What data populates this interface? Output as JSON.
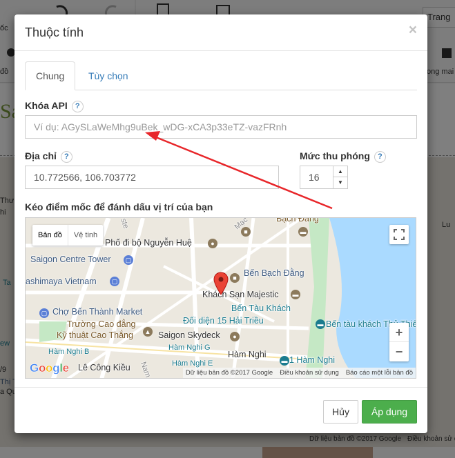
{
  "background": {
    "top_button_label": "Trang",
    "left_tabs": [
      "ốc",
      "đồ",
      "Sá"
    ],
    "right_texts": [
      "ong mai",
      "Lu"
    ],
    "left_map_texts": [
      "Thư",
      "hi",
      "Ta",
      "ew",
      "/9",
      "Thị T",
      "a Qu"
    ],
    "footer_texts": [
      "Dữ liệu bản đồ ©2017 Google",
      "Điều khoản sử dụng"
    ]
  },
  "modal": {
    "title": "Thuộc tính",
    "close_label": "×",
    "tabs": [
      {
        "label": "Chung",
        "active": true
      },
      {
        "label": "Tùy chọn",
        "active": false
      }
    ],
    "api_key": {
      "label": "Khóa API",
      "help": "?",
      "value": "",
      "placeholder": "Ví dụ: AGySLaWeMhg9uBek_wDG-xCA3p33eTZ-vazFRnh"
    },
    "address": {
      "label": "Địa chỉ",
      "help": "?",
      "value": "10.772566, 106.703772"
    },
    "zoom": {
      "label": "Mức thu phóng",
      "help": "?",
      "value": "16",
      "up": "▲",
      "down": "▼"
    },
    "map_section_label": "Kéo điểm mốc để đánh dấu vị trí của bạn",
    "map": {
      "type_buttons": [
        "Bản đồ",
        "Vệ tinh"
      ],
      "zoom_in": "+",
      "zoom_out": "−",
      "logo": "Google",
      "attribution": [
        "Dữ liệu bản đồ ©2017 Google",
        "Điều khoản sử dụng",
        "Báo cáo một lỗi bản đồ"
      ],
      "places": {
        "bach_dang_top": "Bạch Đằng",
        "pho_di_bo": "Phố đi bộ Nguyễn Huệ",
        "saigon_centre": "Saigon Centre Tower",
        "takashimaya": "ashimaya Vietnam",
        "ben_bach_dang": "Bến Bạch Đằng",
        "khach_san": "Khách Sạn Majestic",
        "ben_tau": "Bến Tàu Khách",
        "ben_thanh": "Chợ Bến Thành Market",
        "cao_dang_1": "Trường Cao đẳng",
        "cao_dang_2": "Kỹ thuật Cao Thắng",
        "doi_dien": "Đối diện 15 Hải Triều",
        "ben_tau_khach": "Bến tàu khách Thủ Thiê",
        "skydeck": "Saigon Skydeck",
        "ham_nghi_g": "Hàm Nghi G",
        "ham_nghi": "Hàm Nghi",
        "ham_nghi_b": "Hàm Nghi B",
        "ham_nghi_e": "Hàm Nghi E",
        "ham_nghi_1": "1 Hàm Nghi",
        "le_cong_kieu": "Lê Công Kiều",
        "street_mac": "Mạc",
        "street_nam": "Nam",
        "street_ste": "ste"
      }
    },
    "buttons": {
      "cancel": "Hủy",
      "apply": "Áp dụng"
    }
  },
  "colors": {
    "accent_blue": "#337ab7",
    "apply_green": "#5cb85c",
    "arrow_red": "#e8262a",
    "water": "#aadaff",
    "park": "#c5e8c5"
  }
}
